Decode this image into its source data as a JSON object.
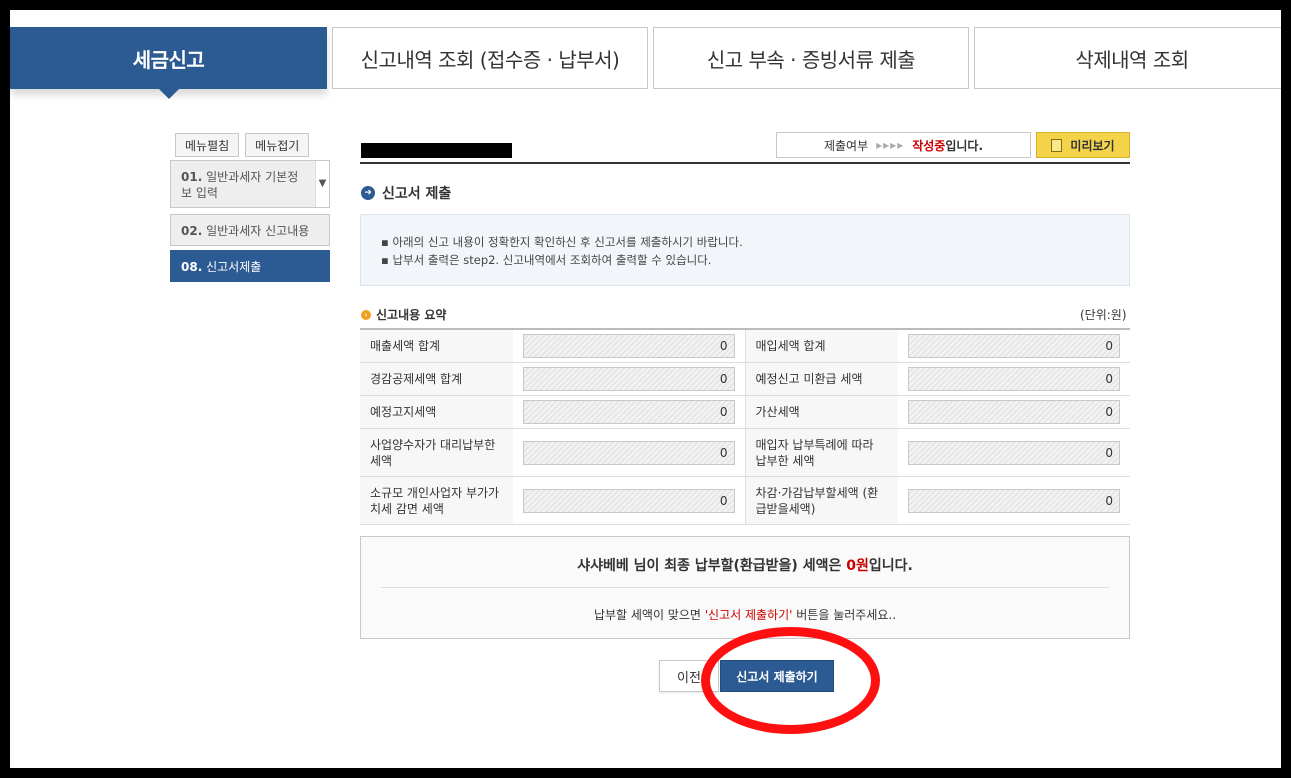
{
  "tabs": [
    {
      "label": "세금신고"
    },
    {
      "label": "신고내역 조회 (접수증 · 납부서)"
    },
    {
      "label": "신고 부속 · 증빙서류 제출"
    },
    {
      "label": "삭제내역 조회"
    }
  ],
  "sidebar": {
    "expand_label": "메뉴펼침",
    "collapse_label": "메뉴접기",
    "items": [
      {
        "num": "01.",
        "label": "일반과세자 기본정보 입력"
      },
      {
        "num": "02.",
        "label": "일반과세자 신고내용"
      },
      {
        "num": "08.",
        "label": "신고서제출"
      }
    ]
  },
  "status": {
    "prefix": "제출여부",
    "arrows": "▸▸▸▸",
    "state": "작성중",
    "suffix": "입니다."
  },
  "preview_label": "미리보기",
  "section": {
    "title": "신고서 제출",
    "notes": [
      "아래의 신고 내용이 정확한지 확인하신 후 신고서를 제출하시기 바랍니다.",
      "납부서 출력은 step2. 신고내역에서 조회하여 출력할 수 있습니다."
    ]
  },
  "summary": {
    "title": "신고내용 요약",
    "unit": "(단위:원)",
    "rows": [
      {
        "l1": "매출세액 합계",
        "v1": "0",
        "l2": "매입세액 합계",
        "v2": "0"
      },
      {
        "l1": "경감공제세액 합계",
        "v1": "0",
        "l2": "예정신고 미환급 세액",
        "v2": "0"
      },
      {
        "l1": "예정고지세액",
        "v1": "0",
        "l2": "가산세액",
        "v2": "0"
      },
      {
        "l1": "사업양수자가 대리납부한 세액",
        "v1": "0",
        "l2": "매입자 납부특례에 따라 납부한 세액",
        "v2": "0"
      },
      {
        "l1": "소규모 개인사업자 부가가치세 감면 세액",
        "v1": "0",
        "l2": "차감·가감납부할세액 (환급받을세액)",
        "v2": "0"
      }
    ]
  },
  "result": {
    "name": "샤샤베베",
    "line1_mid": " 님이 최종 납부할(환급받을) 세액은 ",
    "amount": "0원",
    "line1_end": "입니다.",
    "line2_start": "납부할 세액이 맞으면 ",
    "line2_red": "'신고서 제출하기'",
    "line2_end": " 버튼을 눌러주세요.."
  },
  "buttons": {
    "prev": "이전",
    "submit": "신고서 제출하기"
  },
  "colors": {
    "primary": "#2c5a93",
    "highlight": "#ff1010",
    "preview": "#f3d34a",
    "status_red": "#cc0000"
  }
}
